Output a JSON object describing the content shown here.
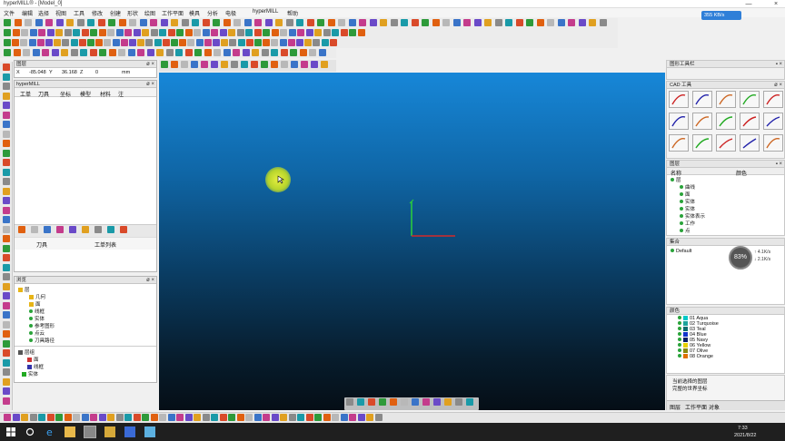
{
  "window": {
    "title": "hyperMILL® - [Model_0]",
    "minimize": "—",
    "close": "×"
  },
  "menu": [
    "文件",
    "编辑",
    "选择",
    "视图",
    "工具",
    "修改",
    "创建",
    "形状",
    "绘图",
    "工作平面",
    "模具",
    "分析",
    "电极",
    " ",
    "hyperMILL",
    "帮助"
  ],
  "speed_badge": "355 KB/s",
  "status": {
    "x_label": "X",
    "x_value": "-85.048",
    "y_label": "Y",
    "y_value": "36.168",
    "z_label": "Z",
    "z_value": "0",
    "unit": "mm"
  },
  "left_top_panel": {
    "title": "图层",
    "controls": "ø ×"
  },
  "job_panel": {
    "title": "hyperMILL",
    "columns": [
      "工单",
      "刀具",
      "坐标",
      "模型",
      "材料",
      "注"
    ],
    "footer_left": "刀具",
    "footer_right": "工单列表"
  },
  "browser_panel": {
    "title": "浏览",
    "items": [
      "层",
      "几何",
      "面",
      "线框",
      "实体",
      "参考图形",
      "点云",
      "刀具路径"
    ],
    "sub_items": [
      "层组",
      "面",
      "线框",
      "实体"
    ]
  },
  "right_panel_top": {
    "title": "图形工具栏",
    "controls": "▪ ×"
  },
  "cad_tools": {
    "title": "CAD 工具",
    "controls": "ø ×"
  },
  "layer_panel": {
    "title": "图层",
    "columns": [
      "名称",
      "颜色"
    ],
    "items": [
      "层",
      "曲线",
      "面",
      "实体",
      "实体",
      "实体表示",
      "工作",
      "点"
    ]
  },
  "sets_panel": {
    "title": "集合",
    "item": "Default"
  },
  "colors_panel": {
    "title": "颜色",
    "items": [
      {
        "label": "01 Aqua",
        "color": "#00c8c8"
      },
      {
        "label": "02 Turquoise",
        "color": "#1aa39b"
      },
      {
        "label": "03 Teal",
        "color": "#0c6e6e"
      },
      {
        "label": "04 Blue",
        "color": "#1133cc"
      },
      {
        "label": "05 Navy",
        "color": "#0a1f66"
      },
      {
        "label": "06 Yellow",
        "color": "#e8d000"
      },
      {
        "label": "07 Olive",
        "color": "#8a8a10"
      },
      {
        "label": "08 Orange",
        "color": "#e07000"
      }
    ]
  },
  "bottom_right_tabs": [
    "图层",
    "工作平面",
    "对象"
  ],
  "bottom_right_list": [
    "当前选择的图层",
    "完整的世界坐标"
  ],
  "cpu_widget": "83%",
  "cpu_side": [
    "↑ 4.1K/s",
    "↓ 2.1K/s"
  ],
  "taskbar": {
    "time": "7:33",
    "date": "2021/8/22"
  }
}
